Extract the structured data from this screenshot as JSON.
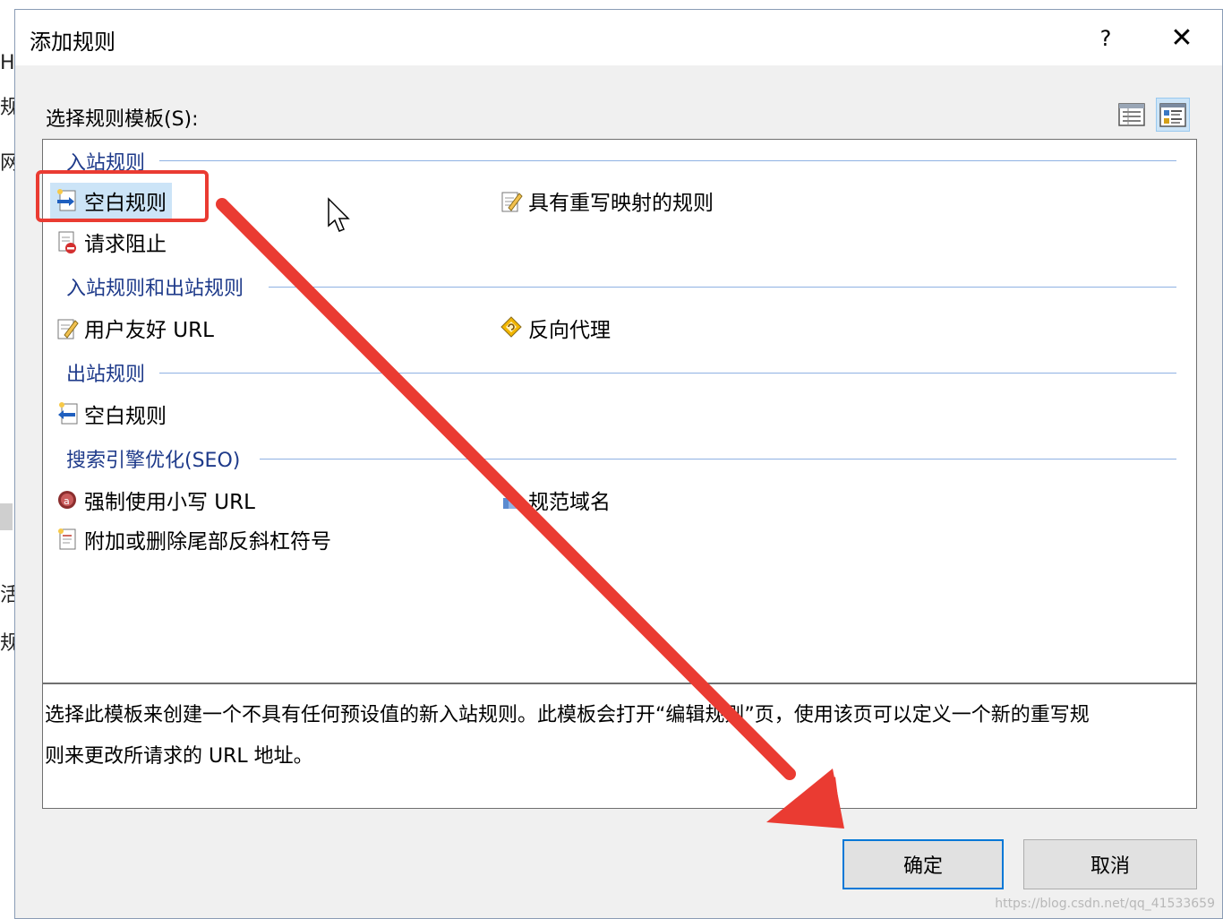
{
  "background": {
    "fragments": [
      "H",
      "规",
      "网",
      "活",
      "规"
    ]
  },
  "dialog": {
    "title": "添加规则",
    "help": "?",
    "close": "✕"
  },
  "select_label": "选择规则模板(S):",
  "groups": [
    {
      "header": "入站规则"
    },
    {
      "header": "入站规则和出站规则"
    },
    {
      "header": "出站规则"
    },
    {
      "header": "搜索引擎优化(SEO)"
    }
  ],
  "items": {
    "blank_inbound": "空白规则",
    "rewrite_map": "具有重写映射的规则",
    "request_block": "请求阻止",
    "friendly_url": "用户友好 URL",
    "reverse_proxy": "反向代理",
    "blank_outbound": "空白规则",
    "lowercase_url": "强制使用小写 URL",
    "canonical_domain": "规范域名",
    "trailing_slash": "附加或删除尾部反斜杠符号"
  },
  "selected_item": "blank_inbound",
  "description": {
    "line1": "选择此模板来创建一个不具有任何预设值的新入站规则。此模板会打开“编辑规则”页，使用该页可以定义一个新的重写规",
    "line2": "则来更改所请求的 URL 地址。"
  },
  "buttons": {
    "ok": "确定",
    "cancel": "取消"
  },
  "watermark": "https://blog.csdn.net/qq_41533659",
  "colors": {
    "annotation_red": "#ea3b32",
    "selection_blue": "#cce4f7",
    "group_header": "#1e3a8a",
    "default_button_border": "#0078d7"
  }
}
